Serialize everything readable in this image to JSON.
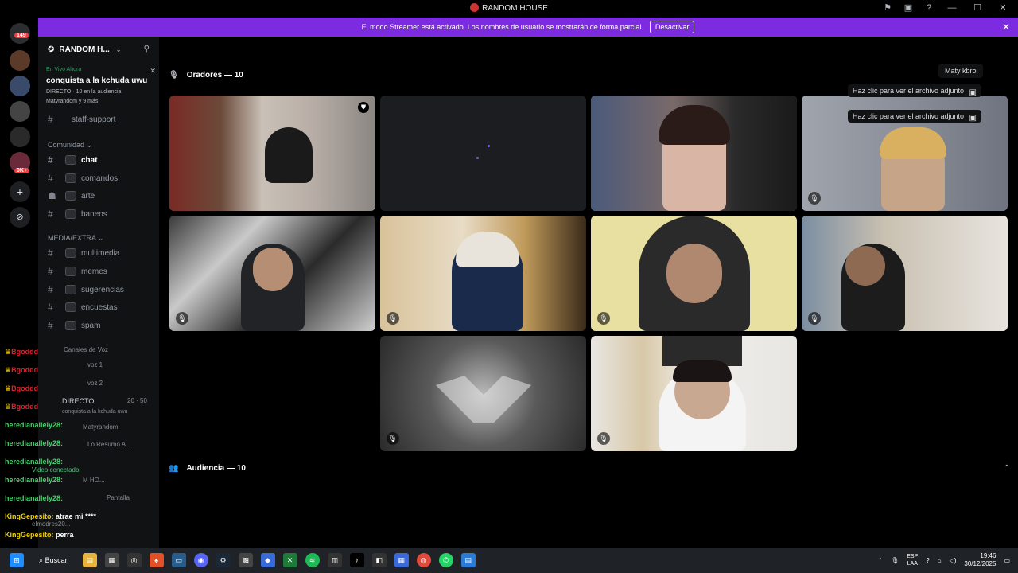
{
  "window": {
    "title": "RANDOM HOUSE"
  },
  "banner": {
    "message": "El modo Streamer está activado. Los nombres de usuario se mostrarán de forma parcial.",
    "button": "Desactivar"
  },
  "rail": {
    "badge_top": "149",
    "badge_mid": "9K+"
  },
  "sidebar": {
    "server_name": "RANDOM H...",
    "live": {
      "label": "En Vivo Ahora",
      "title": "conquista a la kchuda uwu",
      "meta": "DIRECTO · 10 en la audiencia",
      "people": "Matyrandom y 9 más"
    },
    "channel_partial": "staff-support",
    "cat_comunidad": "Comunidad",
    "channels_comunidad": [
      "chat",
      "comandos",
      "arte",
      "baneos"
    ],
    "cat_media": "MEDIA/EXTRA",
    "channels_media": [
      "multimedia",
      "memes",
      "sugerencias",
      "encuestas",
      "spam"
    ],
    "cat_voz": "Canales de Voz",
    "voice": [
      "voz 1",
      "voz 2"
    ],
    "directo": "DIRECTO",
    "directo_sub": "conquista a la kchuda uwu",
    "directo_count": "20 · 50",
    "user_matyrandom": "Matyrandom",
    "user_resumo": "Lo Resumo A...",
    "video_connected": "Video conectado",
    "user_hm": "M HO...",
    "pantalla": "Pantalla",
    "user_bottom": "elmodres20..."
  },
  "overlay_chat": [
    {
      "user": "Bgoddd",
      "text": "",
      "color": "red"
    },
    {
      "user": "Bgoddd",
      "text": "",
      "color": "red"
    },
    {
      "user": "Bgoddd",
      "text": "",
      "color": "red"
    },
    {
      "user": "Bgoddd",
      "text": "",
      "color": "red"
    },
    {
      "user": "heredianallely28:",
      "text": "",
      "color": "green"
    },
    {
      "user": "heredianallely28:",
      "text": "",
      "color": "green"
    },
    {
      "user": "heredianallely28:",
      "text": "",
      "color": "green"
    },
    {
      "user": "heredianallely28:",
      "text": "",
      "color": "green"
    },
    {
      "user": "heredianallely28:",
      "text": "",
      "color": "green"
    },
    {
      "user": "KingGepesito:",
      "text": "atrae mi ****",
      "color": "yellow"
    },
    {
      "user": "KingGepesito:",
      "text": "perra",
      "color": "yellow"
    }
  ],
  "stage": {
    "speakers_label": "Oradores — 10",
    "audience_label": "Audiencia — 10",
    "tooltip_user": "Maty kbro",
    "attach_text": "Haz clic para ver el archivo adjunto",
    "tiles": [
      {
        "id": "t1",
        "speaking": true,
        "muted": false,
        "badge": true
      },
      {
        "id": "t2",
        "speaking": false,
        "muted": false,
        "badge": false
      },
      {
        "id": "t3",
        "speaking": true,
        "muted": false,
        "badge": false
      },
      {
        "id": "t4",
        "speaking": false,
        "muted": true,
        "badge": false
      },
      {
        "id": "t5",
        "speaking": false,
        "muted": true,
        "badge": false
      },
      {
        "id": "t6",
        "speaking": false,
        "muted": true,
        "badge": false
      },
      {
        "id": "t7",
        "speaking": false,
        "muted": true,
        "badge": false
      },
      {
        "id": "t8",
        "speaking": false,
        "muted": true,
        "badge": false
      },
      {
        "id": "t9",
        "speaking": false,
        "muted": true,
        "badge": false
      },
      {
        "id": "t10",
        "speaking": false,
        "muted": true,
        "badge": false
      }
    ]
  },
  "taskbar": {
    "search": "Buscar",
    "lang_top": "ESP",
    "lang_bottom": "LAA",
    "time": "19:46",
    "date": "30/12/2025"
  },
  "colors": {
    "accent": "#7d2be0",
    "speaking": "#23a55a",
    "danger": "#f23f42"
  }
}
